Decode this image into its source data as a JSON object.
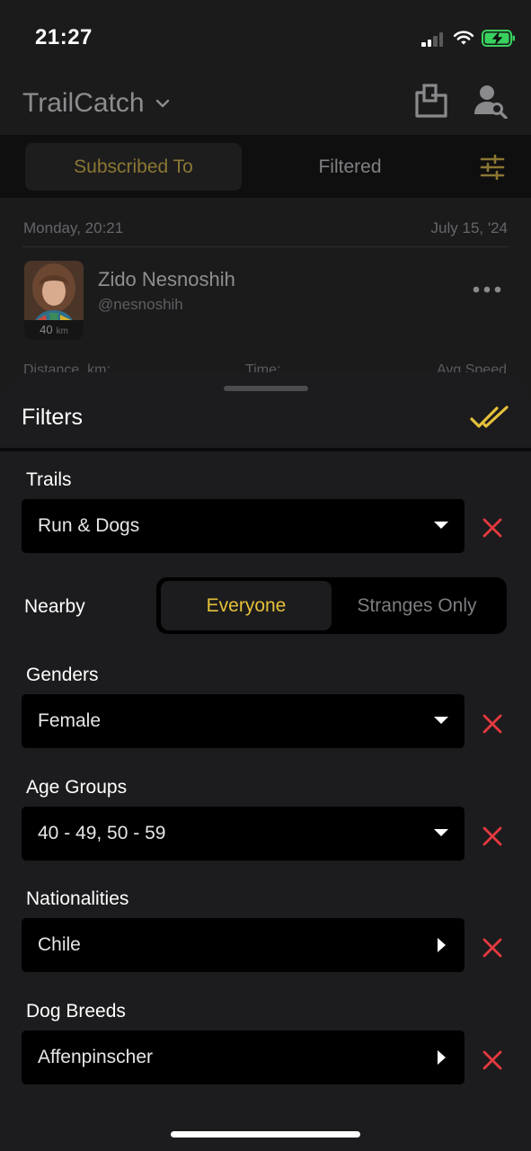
{
  "status_bar": {
    "time": "21:27"
  },
  "header": {
    "app_title": "TrailCatch"
  },
  "tabs": {
    "subscribed": "Subscribed To",
    "filtered": "Filtered"
  },
  "feed": {
    "day_time": "Monday, 20:21",
    "date": "July 15, '24",
    "user": {
      "name": "Zido Nesnoshih",
      "handle": "@nesnoshih",
      "distance": "40",
      "distance_unit": "km"
    },
    "stats": [
      "Distance, km:",
      "Time:",
      "Avg Speed"
    ]
  },
  "filters": {
    "title": "Filters",
    "trails": {
      "label": "Trails",
      "value": "Run & Dogs"
    },
    "nearby": {
      "label": "Nearby",
      "options": [
        "Everyone",
        "Stranges Only"
      ],
      "selected": "Everyone"
    },
    "genders": {
      "label": "Genders",
      "value": "Female"
    },
    "age_groups": {
      "label": "Age Groups",
      "value": "40 - 49, 50 - 59"
    },
    "nationalities": {
      "label": "Nationalities",
      "value": "Chile"
    },
    "dog_breeds": {
      "label": "Dog Breeds",
      "value": "Affenpinscher"
    }
  },
  "colors": {
    "accent": "#e6c13a",
    "clear": "#e5393f",
    "sheet_bg": "#1c1c1e",
    "field_bg": "#000000"
  },
  "icons": [
    "signal-icon",
    "wifi-icon",
    "battery-charging-icon",
    "chevron-down-icon",
    "share-icon",
    "user-search-icon",
    "sliders-icon",
    "more-icon",
    "double-check-icon",
    "close-icon",
    "caret-down-icon",
    "caret-right-icon"
  ]
}
